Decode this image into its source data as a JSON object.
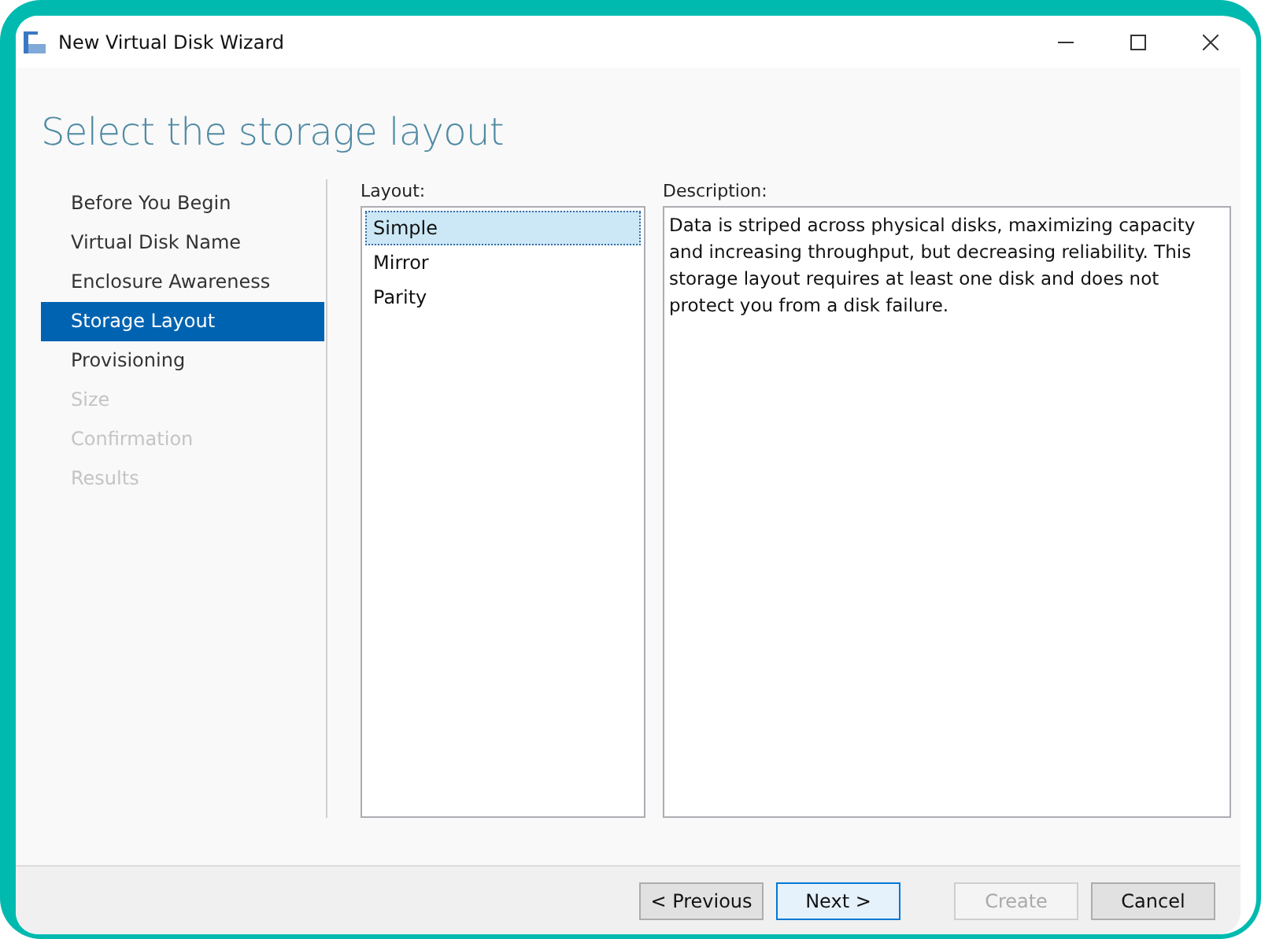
{
  "window": {
    "title": "New Virtual Disk Wizard"
  },
  "heading": "Select the storage layout",
  "sidebar": {
    "items": [
      {
        "label": "Before You Begin",
        "selected": false,
        "disabled": false
      },
      {
        "label": "Virtual Disk Name",
        "selected": false,
        "disabled": false
      },
      {
        "label": "Enclosure Awareness",
        "selected": false,
        "disabled": false
      },
      {
        "label": "Storage Layout",
        "selected": true,
        "disabled": false
      },
      {
        "label": "Provisioning",
        "selected": false,
        "disabled": false
      },
      {
        "label": "Size",
        "selected": false,
        "disabled": true
      },
      {
        "label": "Confirmation",
        "selected": false,
        "disabled": true
      },
      {
        "label": "Results",
        "selected": false,
        "disabled": true
      }
    ]
  },
  "layout": {
    "label": "Layout:",
    "items": [
      {
        "label": "Simple",
        "selected": true
      },
      {
        "label": "Mirror",
        "selected": false
      },
      {
        "label": "Parity",
        "selected": false
      }
    ]
  },
  "description": {
    "label": "Description:",
    "text": "Data is striped across physical disks, maximizing capacity and increasing throughput, but decreasing reliability. This storage layout requires at least one disk and does not protect you from a disk failure."
  },
  "buttons": [
    {
      "label": "< Previous",
      "disabled": false,
      "default": false
    },
    {
      "label": "Next >",
      "disabled": false,
      "default": true
    },
    {
      "label": "Create",
      "disabled": true,
      "default": false
    },
    {
      "label": "Cancel",
      "disabled": false,
      "default": false
    }
  ]
}
